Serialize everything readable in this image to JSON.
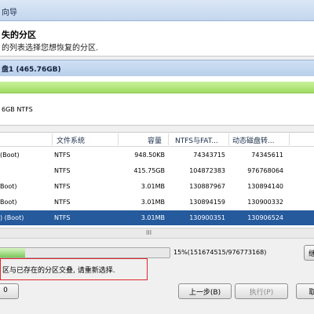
{
  "window": {
    "title": "向导"
  },
  "header": {
    "title": "失的分区",
    "description": "的列表选择您想恢复的分区."
  },
  "disk": {
    "label": "盘1 (465.76GB)",
    "map_label": "6GB NTFS",
    "bar_color": "#a9e36f"
  },
  "table": {
    "headers": [
      "文件系统",
      "容量",
      "NTFS与FAT...",
      "动态磁盘转..."
    ],
    "rows": [
      {
        "name": "(Boot)",
        "fs": "NTFS",
        "size": "948.50KB",
        "v1": "74343715",
        "v2": "74345611",
        "selected": false
      },
      {
        "name": "",
        "fs": "NTFS",
        "size": "415.75GB",
        "v1": "104872383",
        "v2": "976768064",
        "selected": false
      },
      {
        "name": "Boot)",
        "fs": "NTFS",
        "size": "3.01MB",
        "v1": "130887967",
        "v2": "130894140",
        "selected": false
      },
      {
        "name": "Boot)",
        "fs": "NTFS",
        "size": "3.01MB",
        "v1": "130894159",
        "v2": "130900332",
        "selected": false
      },
      {
        "name": ") (Boot)",
        "fs": "NTFS",
        "size": "3.01MB",
        "v1": "130900351",
        "v2": "130906524",
        "selected": true
      }
    ],
    "scroll_grip": "III"
  },
  "progress": {
    "text": "15%(151674515/976773168)",
    "percent": 15
  },
  "right_button": {
    "label": "继"
  },
  "error": {
    "message": "区与已存在的分区交叠, 请重新选择."
  },
  "buttons": {
    "left": "0",
    "prev": "上一步(B)",
    "exec": "执行(P)",
    "cut": "取"
  },
  "colors": {
    "selection": "#255a9c",
    "error_border": "#e0262d"
  }
}
